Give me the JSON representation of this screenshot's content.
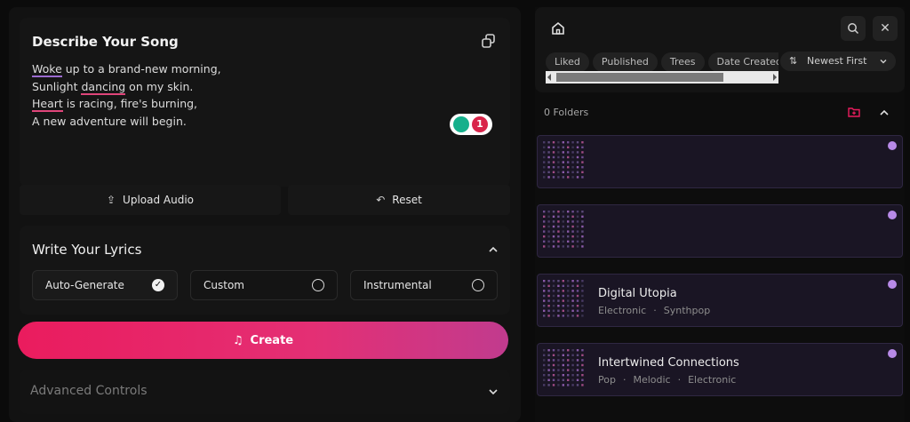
{
  "describe": {
    "title": "Describe Your Song",
    "lines": [
      {
        "pre": "",
        "u": "Woke",
        "post": " up to a brand-new morning,"
      },
      {
        "pre": "Sunlight ",
        "u": "dancing",
        "post": " on my skin."
      },
      {
        "pre": "",
        "u": "Heart",
        "post": " is racing, fire's burning,"
      },
      {
        "pre": "A new adventure will begin.",
        "u": "",
        "post": ""
      }
    ],
    "grammar_count": "1"
  },
  "actions": {
    "upload": "Upload Audio",
    "reset": "Reset"
  },
  "write": {
    "title": "Write Your Lyrics",
    "options": [
      "Auto-Generate",
      "Custom",
      "Instrumental"
    ],
    "selected": "Auto-Generate"
  },
  "create_label": "Create",
  "advanced_label": "Advanced Controls",
  "right": {
    "chips": [
      "Liked",
      "Published",
      "Trees",
      "Date Created"
    ],
    "sort_label": "Newest First",
    "folders_label": "0 Folders",
    "cards": [
      {
        "title": "",
        "tags": []
      },
      {
        "title": "",
        "tags": []
      },
      {
        "title": "Digital Utopia",
        "tags": [
          "Electronic",
          "Synthpop"
        ]
      },
      {
        "title": "Intertwined Connections",
        "tags": [
          "Pop",
          "Melodic",
          "Electronic"
        ]
      }
    ]
  },
  "colors": {
    "accent": "#ea1c5e",
    "card_bg": "#1a1524",
    "dot": "#b88ae8"
  }
}
